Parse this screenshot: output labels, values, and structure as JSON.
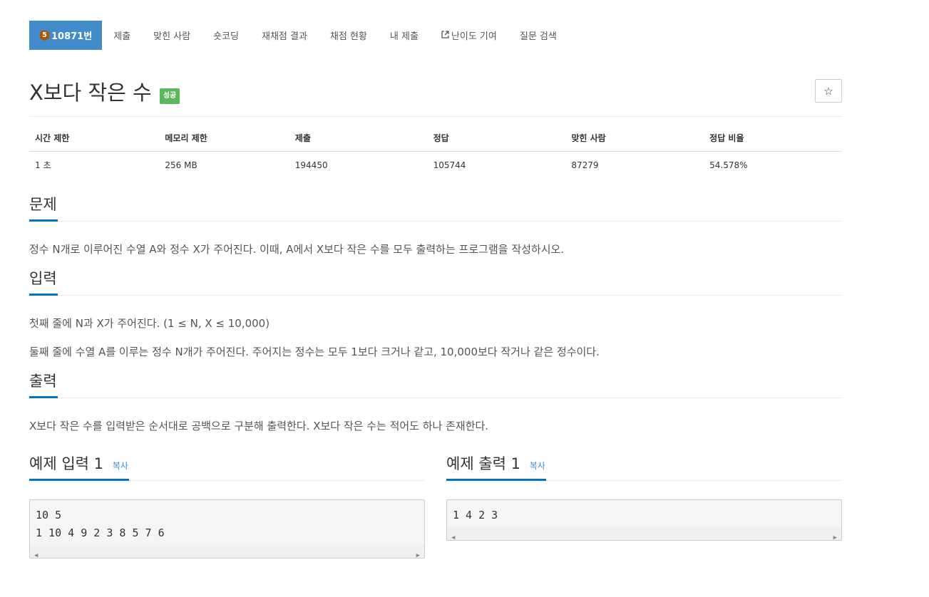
{
  "nav": {
    "problem_tier": "5",
    "problem_number": "10871번",
    "tabs": [
      "제출",
      "맞힌 사람",
      "숏코딩",
      "재채점 결과",
      "채점 현황",
      "내 제출",
      "난이도 기여",
      "질문 검색"
    ]
  },
  "problem": {
    "title": "X보다 작은 수",
    "status_badge": "성공",
    "star_icon": "☆"
  },
  "info_table": {
    "headers": [
      "시간 제한",
      "메모리 제한",
      "제출",
      "정답",
      "맞힌 사람",
      "정답 비율"
    ],
    "values": [
      "1 초",
      "256 MB",
      "194450",
      "105744",
      "87279",
      "54.578%"
    ]
  },
  "sections": {
    "problem": {
      "title": "문제",
      "body": "정수 N개로 이루어진 수열 A와 정수 X가 주어진다. 이때, A에서 X보다 작은 수를 모두 출력하는 프로그램을 작성하시오."
    },
    "input": {
      "title": "입력",
      "line1": "첫째 줄에 N과 X가 주어진다. (1 ≤ N, X ≤ 10,000)",
      "line2": "둘째 줄에 수열 A를 이루는 정수 N개가 주어진다. 주어지는 정수는 모두 1보다 크거나 같고, 10,000보다 작거나 같은 정수이다."
    },
    "output": {
      "title": "출력",
      "body": "X보다 작은 수를 입력받은 순서대로 공백으로 구분해 출력한다. X보다 작은 수는 적어도 하나 존재한다."
    }
  },
  "samples": {
    "input": {
      "title": "예제 입력 1",
      "copy": "복사",
      "code": "10 5\n1 10 4 9 2 3 8 5 7 6"
    },
    "output": {
      "title": "예제 출력 1",
      "copy": "복사",
      "code": "1 4 2 3"
    }
  },
  "colors": {
    "active_tab": "#428bca",
    "tier_bronze": "#ad5600",
    "success_badge": "#5cb85c",
    "section_underline": "#0076c0"
  }
}
